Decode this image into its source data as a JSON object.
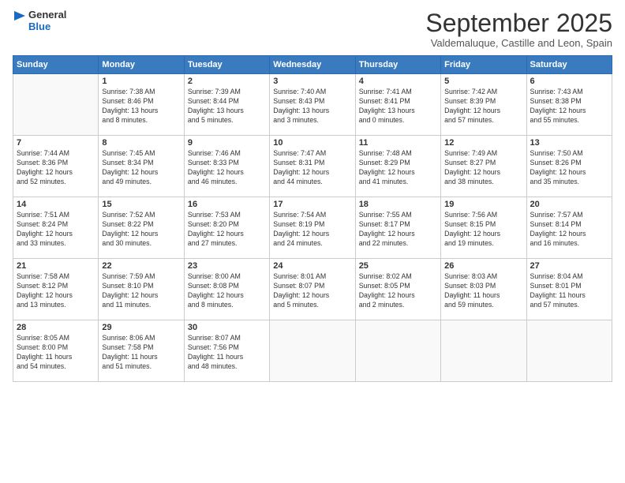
{
  "logo": {
    "general": "General",
    "blue": "Blue"
  },
  "header": {
    "month": "September 2025",
    "location": "Valdemaluque, Castille and Leon, Spain"
  },
  "weekdays": [
    "Sunday",
    "Monday",
    "Tuesday",
    "Wednesday",
    "Thursday",
    "Friday",
    "Saturday"
  ],
  "weeks": [
    [
      {
        "day": "",
        "info": ""
      },
      {
        "day": "1",
        "info": "Sunrise: 7:38 AM\nSunset: 8:46 PM\nDaylight: 13 hours\nand 8 minutes."
      },
      {
        "day": "2",
        "info": "Sunrise: 7:39 AM\nSunset: 8:44 PM\nDaylight: 13 hours\nand 5 minutes."
      },
      {
        "day": "3",
        "info": "Sunrise: 7:40 AM\nSunset: 8:43 PM\nDaylight: 13 hours\nand 3 minutes."
      },
      {
        "day": "4",
        "info": "Sunrise: 7:41 AM\nSunset: 8:41 PM\nDaylight: 13 hours\nand 0 minutes."
      },
      {
        "day": "5",
        "info": "Sunrise: 7:42 AM\nSunset: 8:39 PM\nDaylight: 12 hours\nand 57 minutes."
      },
      {
        "day": "6",
        "info": "Sunrise: 7:43 AM\nSunset: 8:38 PM\nDaylight: 12 hours\nand 55 minutes."
      }
    ],
    [
      {
        "day": "7",
        "info": "Sunrise: 7:44 AM\nSunset: 8:36 PM\nDaylight: 12 hours\nand 52 minutes."
      },
      {
        "day": "8",
        "info": "Sunrise: 7:45 AM\nSunset: 8:34 PM\nDaylight: 12 hours\nand 49 minutes."
      },
      {
        "day": "9",
        "info": "Sunrise: 7:46 AM\nSunset: 8:33 PM\nDaylight: 12 hours\nand 46 minutes."
      },
      {
        "day": "10",
        "info": "Sunrise: 7:47 AM\nSunset: 8:31 PM\nDaylight: 12 hours\nand 44 minutes."
      },
      {
        "day": "11",
        "info": "Sunrise: 7:48 AM\nSunset: 8:29 PM\nDaylight: 12 hours\nand 41 minutes."
      },
      {
        "day": "12",
        "info": "Sunrise: 7:49 AM\nSunset: 8:27 PM\nDaylight: 12 hours\nand 38 minutes."
      },
      {
        "day": "13",
        "info": "Sunrise: 7:50 AM\nSunset: 8:26 PM\nDaylight: 12 hours\nand 35 minutes."
      }
    ],
    [
      {
        "day": "14",
        "info": "Sunrise: 7:51 AM\nSunset: 8:24 PM\nDaylight: 12 hours\nand 33 minutes."
      },
      {
        "day": "15",
        "info": "Sunrise: 7:52 AM\nSunset: 8:22 PM\nDaylight: 12 hours\nand 30 minutes."
      },
      {
        "day": "16",
        "info": "Sunrise: 7:53 AM\nSunset: 8:20 PM\nDaylight: 12 hours\nand 27 minutes."
      },
      {
        "day": "17",
        "info": "Sunrise: 7:54 AM\nSunset: 8:19 PM\nDaylight: 12 hours\nand 24 minutes."
      },
      {
        "day": "18",
        "info": "Sunrise: 7:55 AM\nSunset: 8:17 PM\nDaylight: 12 hours\nand 22 minutes."
      },
      {
        "day": "19",
        "info": "Sunrise: 7:56 AM\nSunset: 8:15 PM\nDaylight: 12 hours\nand 19 minutes."
      },
      {
        "day": "20",
        "info": "Sunrise: 7:57 AM\nSunset: 8:14 PM\nDaylight: 12 hours\nand 16 minutes."
      }
    ],
    [
      {
        "day": "21",
        "info": "Sunrise: 7:58 AM\nSunset: 8:12 PM\nDaylight: 12 hours\nand 13 minutes."
      },
      {
        "day": "22",
        "info": "Sunrise: 7:59 AM\nSunset: 8:10 PM\nDaylight: 12 hours\nand 11 minutes."
      },
      {
        "day": "23",
        "info": "Sunrise: 8:00 AM\nSunset: 8:08 PM\nDaylight: 12 hours\nand 8 minutes."
      },
      {
        "day": "24",
        "info": "Sunrise: 8:01 AM\nSunset: 8:07 PM\nDaylight: 12 hours\nand 5 minutes."
      },
      {
        "day": "25",
        "info": "Sunrise: 8:02 AM\nSunset: 8:05 PM\nDaylight: 12 hours\nand 2 minutes."
      },
      {
        "day": "26",
        "info": "Sunrise: 8:03 AM\nSunset: 8:03 PM\nDaylight: 11 hours\nand 59 minutes."
      },
      {
        "day": "27",
        "info": "Sunrise: 8:04 AM\nSunset: 8:01 PM\nDaylight: 11 hours\nand 57 minutes."
      }
    ],
    [
      {
        "day": "28",
        "info": "Sunrise: 8:05 AM\nSunset: 8:00 PM\nDaylight: 11 hours\nand 54 minutes."
      },
      {
        "day": "29",
        "info": "Sunrise: 8:06 AM\nSunset: 7:58 PM\nDaylight: 11 hours\nand 51 minutes."
      },
      {
        "day": "30",
        "info": "Sunrise: 8:07 AM\nSunset: 7:56 PM\nDaylight: 11 hours\nand 48 minutes."
      },
      {
        "day": "",
        "info": ""
      },
      {
        "day": "",
        "info": ""
      },
      {
        "day": "",
        "info": ""
      },
      {
        "day": "",
        "info": ""
      }
    ]
  ]
}
